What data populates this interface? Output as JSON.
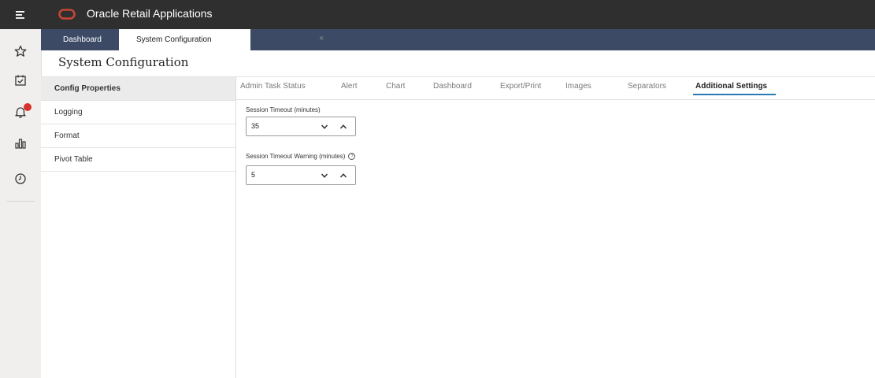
{
  "app": {
    "title": "Oracle Retail Applications",
    "brand_color": "#c74634"
  },
  "rail": {
    "icons": [
      "menu-icon",
      "star-icon",
      "calendar-check-icon",
      "bell-icon",
      "chart-icon",
      "clock-icon"
    ]
  },
  "tabs": {
    "dashboard_label": "Dashboard",
    "sysconf_label": "System Configuration",
    "close_glyph": "×"
  },
  "page": {
    "title": "System Configuration"
  },
  "sidenav": {
    "items": [
      {
        "label": "Config Properties",
        "active": true
      },
      {
        "label": "Logging"
      },
      {
        "label": "Format"
      },
      {
        "label": "Pivot Table"
      }
    ]
  },
  "content_tabs": {
    "items": [
      {
        "label": "Admin Task Status"
      },
      {
        "label": "Alert"
      },
      {
        "label": "Chart"
      },
      {
        "label": "Dashboard"
      },
      {
        "label": "Export/Print"
      },
      {
        "label": "Images"
      },
      {
        "label": "Separators"
      },
      {
        "label": "Additional Settings",
        "active": true
      }
    ]
  },
  "form": {
    "session_timeout": {
      "label": "Session Timeout (minutes)",
      "value": "35"
    },
    "session_timeout_warning": {
      "label": "Session Timeout Warning (minutes)",
      "value": "5"
    }
  }
}
